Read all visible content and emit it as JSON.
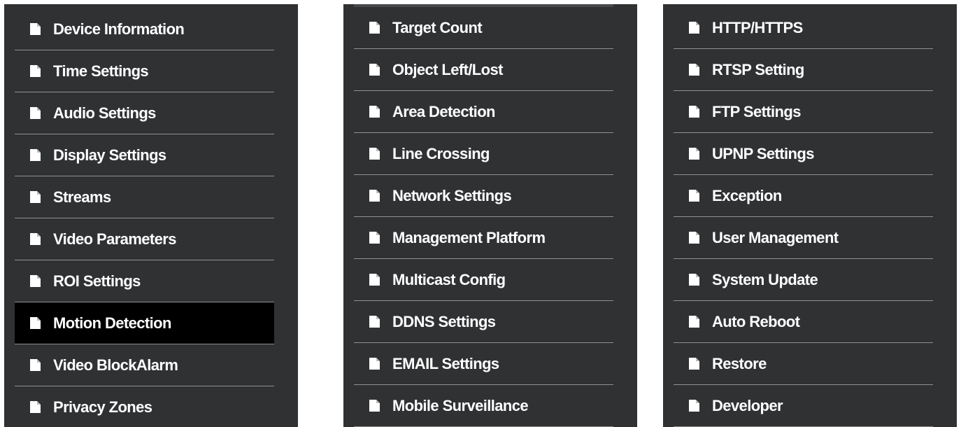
{
  "menus": [
    {
      "items": [
        {
          "label": "Device Information"
        },
        {
          "label": "Time Settings"
        },
        {
          "label": "Audio Settings"
        },
        {
          "label": "Display Settings"
        },
        {
          "label": "Streams"
        },
        {
          "label": "Video Parameters"
        },
        {
          "label": "ROI Settings"
        },
        {
          "label": "Motion Detection",
          "selected": true
        },
        {
          "label": "Video BlockAlarm"
        },
        {
          "label": "Privacy Zones"
        }
      ]
    },
    {
      "items": [
        {
          "label": "Target Count"
        },
        {
          "label": "Object Left/Lost"
        },
        {
          "label": "Area Detection"
        },
        {
          "label": "Line Crossing"
        },
        {
          "label": "Network Settings"
        },
        {
          "label": "Management Platform"
        },
        {
          "label": "Multicast Config"
        },
        {
          "label": "DDNS Settings"
        },
        {
          "label": "EMAIL Settings"
        },
        {
          "label": "Mobile Surveillance"
        }
      ]
    },
    {
      "items": [
        {
          "label": "HTTP/HTTPS"
        },
        {
          "label": "RTSP Setting"
        },
        {
          "label": "FTP Settings"
        },
        {
          "label": "UPNP Settings"
        },
        {
          "label": "Exception"
        },
        {
          "label": "User Management"
        },
        {
          "label": "System Update"
        },
        {
          "label": "Auto Reboot"
        },
        {
          "label": "Restore"
        },
        {
          "label": "Developer"
        }
      ]
    }
  ],
  "icon": "document-icon",
  "colors": {
    "panel_background": "#2f3133",
    "divider": "#8e9092",
    "selected_background": "#000000",
    "text": "#ffffff"
  }
}
